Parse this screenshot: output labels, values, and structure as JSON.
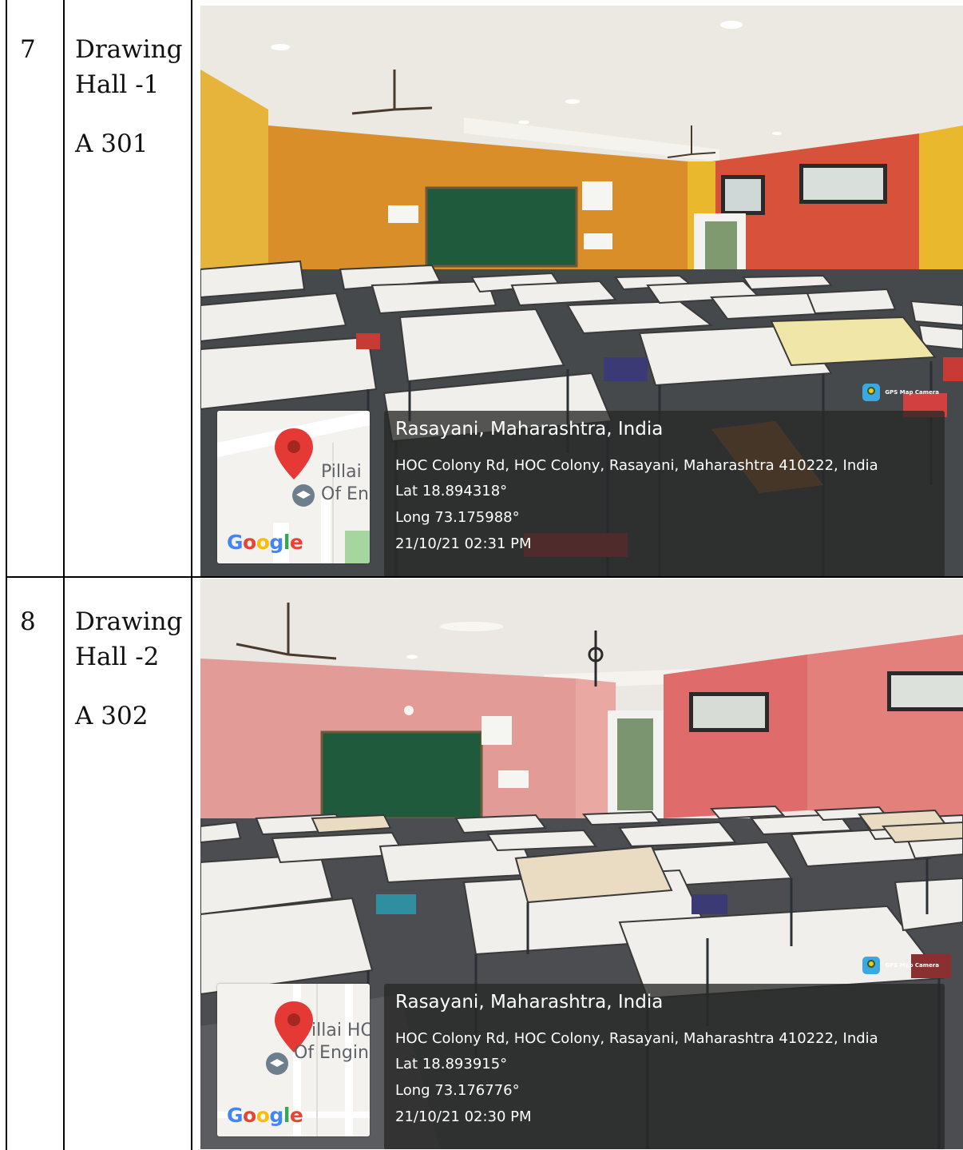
{
  "rows": [
    {
      "number": "7",
      "name_line1": "Drawing",
      "name_line2": "Hall -1",
      "room": "A 301",
      "photo": {
        "wall_colors": {
          "back": "#d98e2a",
          "right": "#d8513a",
          "far_right": "#e9b82d",
          "ceiling": "#ece9e2",
          "floor": "#46494c"
        },
        "map_labels": [
          "Pillai",
          "Of En"
        ],
        "google": "Google",
        "location_title": "Rasayani, Maharashtra, India",
        "address": "HOC Colony Rd, HOC Colony, Rasayani, Maharashtra 410222, India",
        "lat": "Lat 18.894318°",
        "long": "Long 73.175988°",
        "datetime": "21/10/21 02:31 PM",
        "badge": "GPS Map Camera"
      }
    },
    {
      "number": "8",
      "name_line1": "Drawing",
      "name_line2": "Hall -2",
      "room": "A 302",
      "photo": {
        "wall_colors": {
          "back": "#e39b98",
          "right": "#df6b6b",
          "far_right": "#e4807c",
          "ceiling": "#ebe7e2",
          "floor": "#4b4d50"
        },
        "map_labels": [
          "illai HO",
          "Of Engin"
        ],
        "google": "Google",
        "location_title": "Rasayani, Maharashtra, India",
        "address": "HOC Colony Rd, HOC Colony, Rasayani, Maharashtra 410222, India",
        "lat": "Lat 18.893915°",
        "long": "Long 73.176776°",
        "datetime": "21/10/21 02:30 PM",
        "badge": "GPS Map Camera"
      }
    }
  ]
}
